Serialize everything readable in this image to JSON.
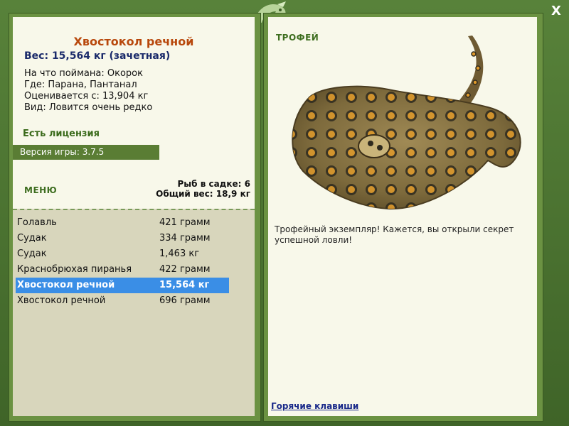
{
  "fish_info": {
    "name": "Хвостокол речной",
    "weight_line": "Вес: 15,564 кг (зачетная)",
    "caught_on": "На что поймана: Окорок",
    "location": "Где: Парана, Пантанал",
    "valued_from": "Оценивается с: 13,904 кг",
    "rarity": "Вид: Ловится очень редко"
  },
  "license": "Есть лицензия",
  "version": "Версия игры: 3.7.5",
  "menu_label": "МЕНЮ",
  "keepnet": {
    "count_text": "Рыб в садке: 6",
    "total_weight_text": "Общий вес: 18,9 кг"
  },
  "catch_list": [
    {
      "name": "Голавль",
      "weight": "421 грамм",
      "selected": false
    },
    {
      "name": "Судак",
      "weight": "334 грамм",
      "selected": false
    },
    {
      "name": "Судак",
      "weight": "1,463 кг",
      "selected": false
    },
    {
      "name": "Краснобрюхая пиранья",
      "weight": "422 грамм",
      "selected": false
    },
    {
      "name": "Хвостокол речной",
      "weight": "15,564 кг",
      "selected": true
    },
    {
      "name": "Хвостокол речной",
      "weight": "696 грамм",
      "selected": false
    }
  ],
  "trophy": {
    "label": "ТРОФЕЙ",
    "description": "Трофейный экземпляр! Кажется, вы открыли секрет успешной ловли!"
  },
  "hotkeys_link": "Горячие клавиши",
  "close_label": "X",
  "colors": {
    "frame_green": "#4d7330",
    "panel_cream": "#f8f8ea",
    "list_bg": "#d8d6bc",
    "title_orange": "#b8480c",
    "weight_navy": "#1a2a6a",
    "selection_blue": "#3a8ee6"
  }
}
